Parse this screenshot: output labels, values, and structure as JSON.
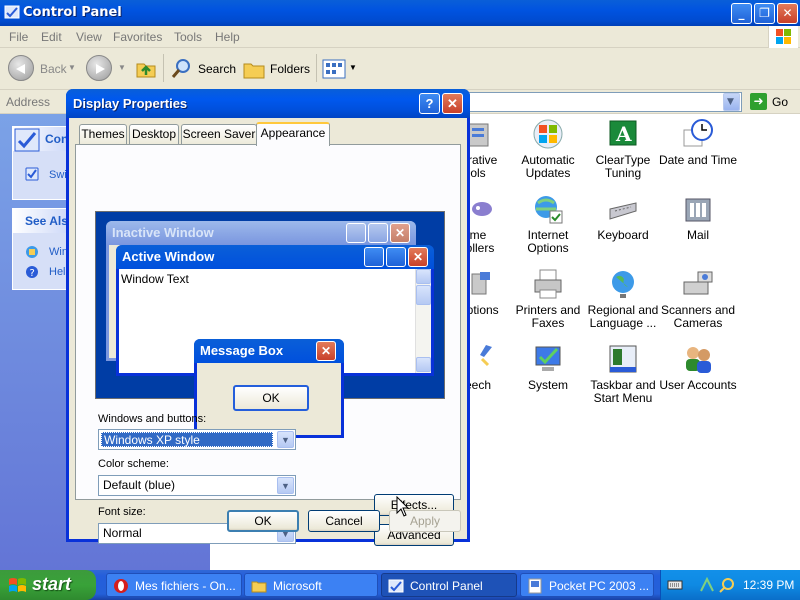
{
  "window": {
    "title": "Control Panel",
    "menu": [
      "File",
      "Edit",
      "View",
      "Favorites",
      "Tools",
      "Help"
    ],
    "toolbar": {
      "back": "Back",
      "search": "Search",
      "folders": "Folders"
    },
    "address": {
      "label": "Address",
      "go": "Go"
    },
    "left_pane": {
      "panel1_title": "Cont",
      "panel1_link": "Swi",
      "panel2_title": "See Als",
      "panel2_links": [
        "Win",
        "Help"
      ]
    },
    "items": [
      {
        "label": "strative\nols",
        "icon": "administrative-tools-icon"
      },
      {
        "label": "Automatic\nUpdates",
        "icon": "automatic-updates-icon"
      },
      {
        "label": "ClearType\nTuning",
        "icon": "cleartype-icon"
      },
      {
        "label": "Date and Time",
        "icon": "date-time-icon"
      },
      {
        "label": "me\nrollers",
        "icon": "game-controllers-icon"
      },
      {
        "label": "Internet\nOptions",
        "icon": "internet-options-icon"
      },
      {
        "label": "Keyboard",
        "icon": "keyboard-icon"
      },
      {
        "label": "Mail",
        "icon": "mail-icon"
      },
      {
        "label": "Options",
        "icon": "options-icon"
      },
      {
        "label": "Printers and\nFaxes",
        "icon": "printer-icon"
      },
      {
        "label": "Regional and\nLanguage ...",
        "icon": "globe-icon"
      },
      {
        "label": "Scanners and\nCameras",
        "icon": "scanner-icon"
      },
      {
        "label": "eech",
        "icon": "speech-icon"
      },
      {
        "label": "System",
        "icon": "system-icon"
      },
      {
        "label": "Taskbar and\nStart Menu",
        "icon": "taskbar-icon"
      },
      {
        "label": "User Accounts",
        "icon": "user-accounts-icon"
      }
    ]
  },
  "dialog": {
    "title": "Display Properties",
    "help": "?",
    "tabs": [
      "Themes",
      "Desktop",
      "Screen Saver",
      "Appearance"
    ],
    "preview": {
      "inactive_title": "Inactive Window",
      "active_title": "Active Window",
      "window_text": "Window Text",
      "msgbox_title": "Message Box",
      "msgbox_ok": "OK"
    },
    "windows_buttons_label": "Windows and buttons:",
    "windows_buttons_value": "Windows XP style",
    "color_scheme_label": "Color scheme:",
    "color_scheme_value": "Default (blue)",
    "font_size_label": "Font size:",
    "font_size_value": "Normal",
    "effects": "Effects...",
    "advanced": "Advanced",
    "ok": "OK",
    "cancel": "Cancel",
    "apply": "Apply"
  },
  "taskbar": {
    "start": "start",
    "tasks": [
      {
        "label": "Mes fichiers - On...",
        "icon": "opera-icon"
      },
      {
        "label": "Microsoft",
        "icon": "folder-icon"
      },
      {
        "label": "Control Panel",
        "icon": "control-panel-icon"
      },
      {
        "label": "Pocket PC 2003 ...",
        "icon": "pocket-pc-icon"
      }
    ],
    "clock": "12:39 PM"
  },
  "colors": {
    "xp_blue": "#0053e0",
    "start_green": "#39a239",
    "selection": "#316ac5"
  }
}
